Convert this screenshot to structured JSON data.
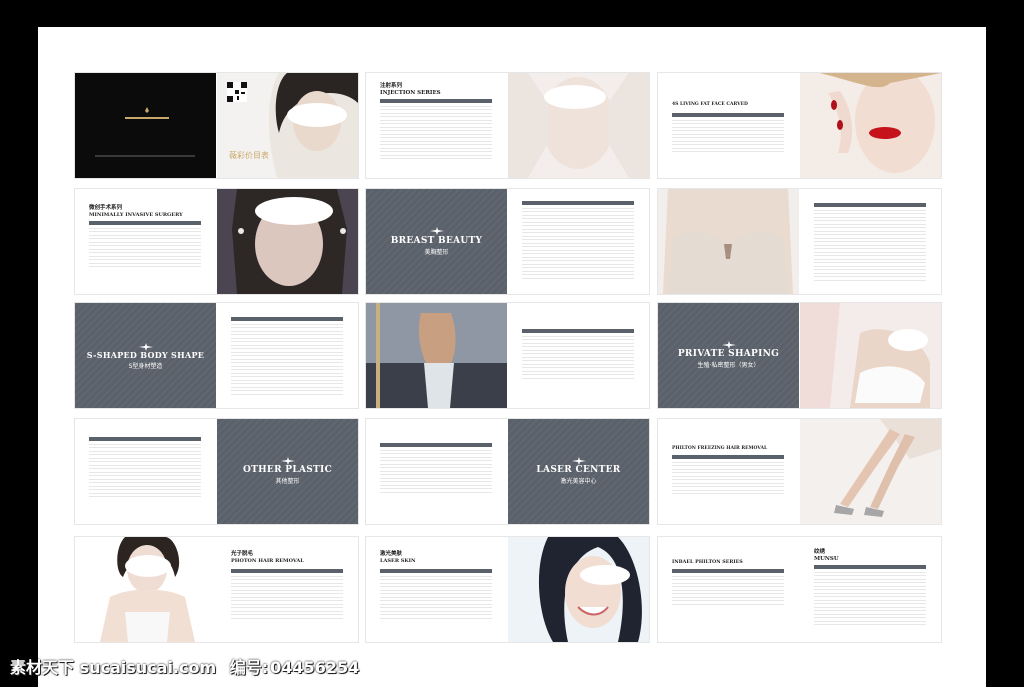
{
  "brochure": {
    "cover": {
      "brand_cn": "",
      "slogan_cn": "薇彩价目表"
    },
    "sections": {
      "injection": "INJECTION SERIES",
      "injection_cn": "注射系列",
      "living_fat": "4S LIVING FAT FACE CARVED",
      "minimally": "MINIMALLY INVASIVE SURGERY",
      "minimally_cn": "微创手术系列",
      "breast": "BREAST BEAUTY",
      "breast_cn": "美胸整形",
      "s_shaped": "S-SHAPED BODY SHAPE",
      "s_shaped_cn": "S型身材塑造",
      "private": "PRIVATE SHAPING",
      "private_cn": "生殖·私密整形（男女）",
      "other": "OTHER PLASTIC",
      "other_cn": "其他整形",
      "laser": "LASER CENTER",
      "laser_cn": "激光美容中心",
      "philton_freezing": "PHILTON FREEZING HAIR REMOVAL",
      "photon": "PHOTON HAIR REMOVAL",
      "photon_cn": "光子脱毛",
      "laser_skin": "LASER SKIN",
      "laser_skin_cn": "激光美肤",
      "inbael": "INBAEL PHILTON SERIES",
      "munsu": "MUNSU",
      "munsu_cn": "纹绣"
    }
  },
  "watermark": {
    "site": "素材天下 sucaisucai.com",
    "id_label": "编号:",
    "id": "04456254"
  },
  "colors": {
    "panel": "#5b616a",
    "accent": "#b59a6a",
    "frame": "#000000"
  }
}
